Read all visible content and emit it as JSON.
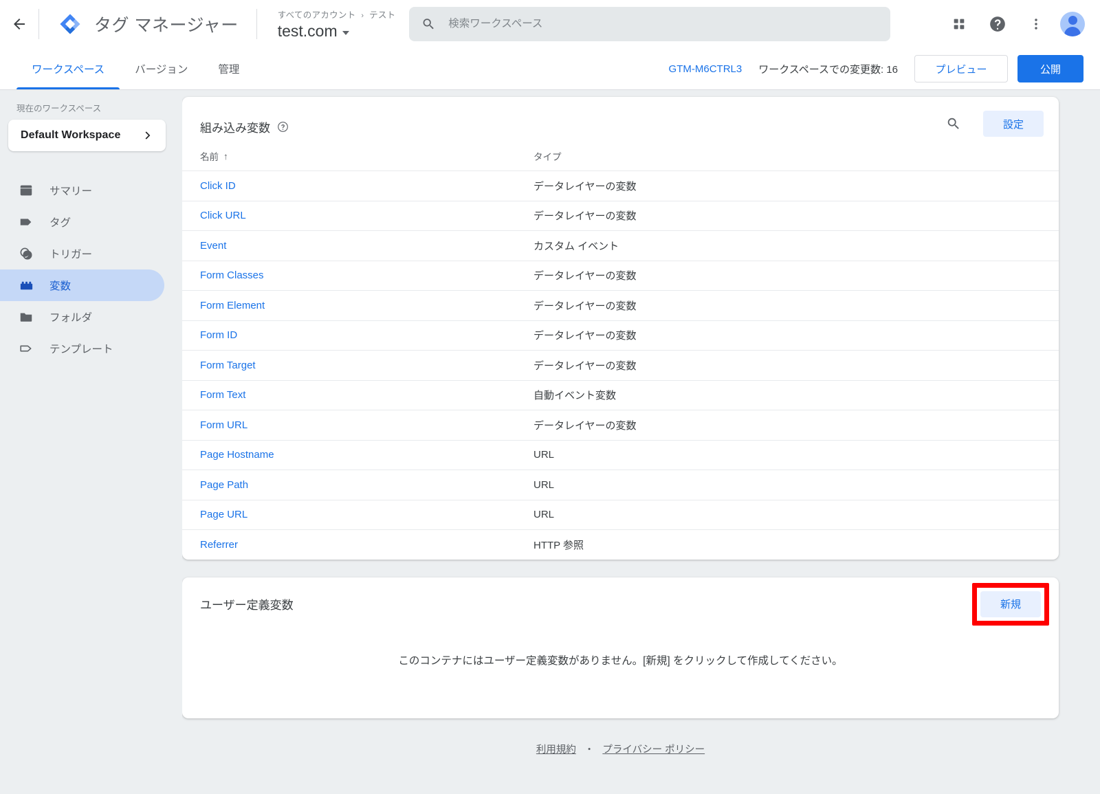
{
  "topbar": {
    "back_label": "戻る",
    "brand_title": "タグ マネージャー",
    "breadcrumb_account": "すべてのアカウント",
    "breadcrumb_sep": "›",
    "breadcrumb_container": "テスト",
    "container_name": "test.com",
    "search_placeholder": "検索ワークスペース",
    "search_value": ""
  },
  "tabs": {
    "items": [
      {
        "label": "ワークスペース",
        "active": true
      },
      {
        "label": "バージョン",
        "active": false
      },
      {
        "label": "管理",
        "active": false
      }
    ],
    "gtm_id": "GTM-M6CTRL3",
    "changes_label": "ワークスペースでの変更数: 16",
    "preview_label": "プレビュー",
    "publish_label": "公開"
  },
  "sidebar": {
    "workspace_label": "現在のワークスペース",
    "workspace_name": "Default Workspace",
    "items": [
      {
        "label": "サマリー",
        "icon": "summary-icon",
        "active": false
      },
      {
        "label": "タグ",
        "icon": "tag-icon",
        "active": false
      },
      {
        "label": "トリガー",
        "icon": "trigger-icon",
        "active": false
      },
      {
        "label": "変数",
        "icon": "variable-icon",
        "active": true
      },
      {
        "label": "フォルダ",
        "icon": "folder-icon",
        "active": false
      },
      {
        "label": "テンプレート",
        "icon": "template-icon",
        "active": false
      }
    ]
  },
  "builtin_card": {
    "title": "組み込み変数",
    "settings_label": "設定",
    "columns": {
      "name": "名前",
      "sort_arrow": "↑",
      "type": "タイプ"
    },
    "rows": [
      {
        "name": "Click ID",
        "type": "データレイヤーの変数"
      },
      {
        "name": "Click URL",
        "type": "データレイヤーの変数"
      },
      {
        "name": "Event",
        "type": "カスタム イベント"
      },
      {
        "name": "Form Classes",
        "type": "データレイヤーの変数"
      },
      {
        "name": "Form Element",
        "type": "データレイヤーの変数"
      },
      {
        "name": "Form ID",
        "type": "データレイヤーの変数"
      },
      {
        "name": "Form Target",
        "type": "データレイヤーの変数"
      },
      {
        "name": "Form Text",
        "type": "自動イベント変数"
      },
      {
        "name": "Form URL",
        "type": "データレイヤーの変数"
      },
      {
        "name": "Page Hostname",
        "type": "URL"
      },
      {
        "name": "Page Path",
        "type": "URL"
      },
      {
        "name": "Page URL",
        "type": "URL"
      },
      {
        "name": "Referrer",
        "type": "HTTP 参照"
      }
    ]
  },
  "user_card": {
    "title": "ユーザー定義変数",
    "new_label": "新規",
    "empty_text": "このコンテナにはユーザー定義変数がありません。[新規] をクリックして作成してください。"
  },
  "footer": {
    "terms": "利用規約",
    "separator": "・",
    "privacy": "プライバシー ポリシー"
  },
  "colors": {
    "accent": "#1a73e8",
    "page_bg": "#eceff1",
    "highlight": "#ff0000",
    "nav_active_bg": "#c5d8f7",
    "tonal_btn_bg": "#e8f0fe"
  }
}
